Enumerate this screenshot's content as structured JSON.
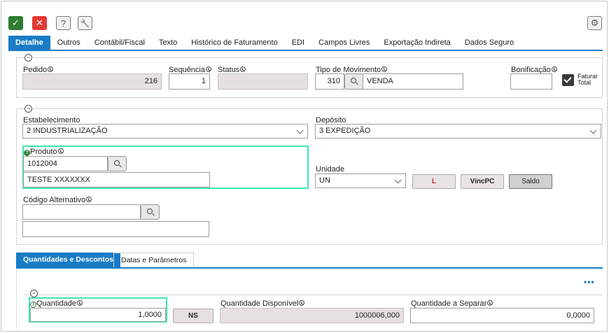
{
  "toolbar": {
    "confirm_glyph": "✓",
    "cancel_glyph": "✕",
    "help_glyph": "?",
    "tools_glyph": "🔧",
    "settings_glyph": "⚙"
  },
  "tabs": [
    "Detalhe",
    "Outros",
    "Contábil/Fiscal",
    "Texto",
    "Histórico de Faturamento",
    "EDI",
    "Campos Livres",
    "Exportação Indireta",
    "Dados Seguro"
  ],
  "section1": {
    "pedido": {
      "label": "Pedido",
      "value": "216"
    },
    "sequencia": {
      "label": "Sequência",
      "value": "1"
    },
    "status": {
      "label": "Status",
      "value": ""
    },
    "tipo_movimento": {
      "label": "Tipo de Movimento",
      "code": "310",
      "desc": "VENDA"
    },
    "bonificacao": {
      "label": "Bonificação",
      "value": ""
    },
    "faturar_total": {
      "label1": "Faturar",
      "label2": "Total",
      "checked": true
    }
  },
  "section2": {
    "estabelecimento": {
      "label": "Estabelecimento",
      "value": "2 INDUSTRIALIZAÇÃO"
    },
    "deposito": {
      "label": "Depósito",
      "value": "3 EXPEDIÇÃO"
    },
    "produto": {
      "label": "Produto",
      "code": "1012004",
      "desc": "TESTE XXXXXXX"
    },
    "unidade": {
      "label": "Unidade",
      "value": "UN"
    },
    "buttons": {
      "l_label": "L",
      "vincpc_label": "VincPC",
      "saldo_label": "Saldo"
    },
    "codigo_alternativo": {
      "label": "Código Alternativo",
      "value": "",
      "desc": ""
    }
  },
  "subtabs": [
    "Quantidades e Descontos",
    "Datas e Parâmetros"
  ],
  "section3": {
    "more_glyph": "•••",
    "quantidade": {
      "label": "Quantidade",
      "value": "1,0000"
    },
    "ns_label": "NS",
    "quantidade_disponivel": {
      "label": "Quantidade Disponível",
      "value": "1000006,000"
    },
    "quantidade_separar": {
      "label": "Quantidade a Separar",
      "value": "0,0000"
    }
  }
}
